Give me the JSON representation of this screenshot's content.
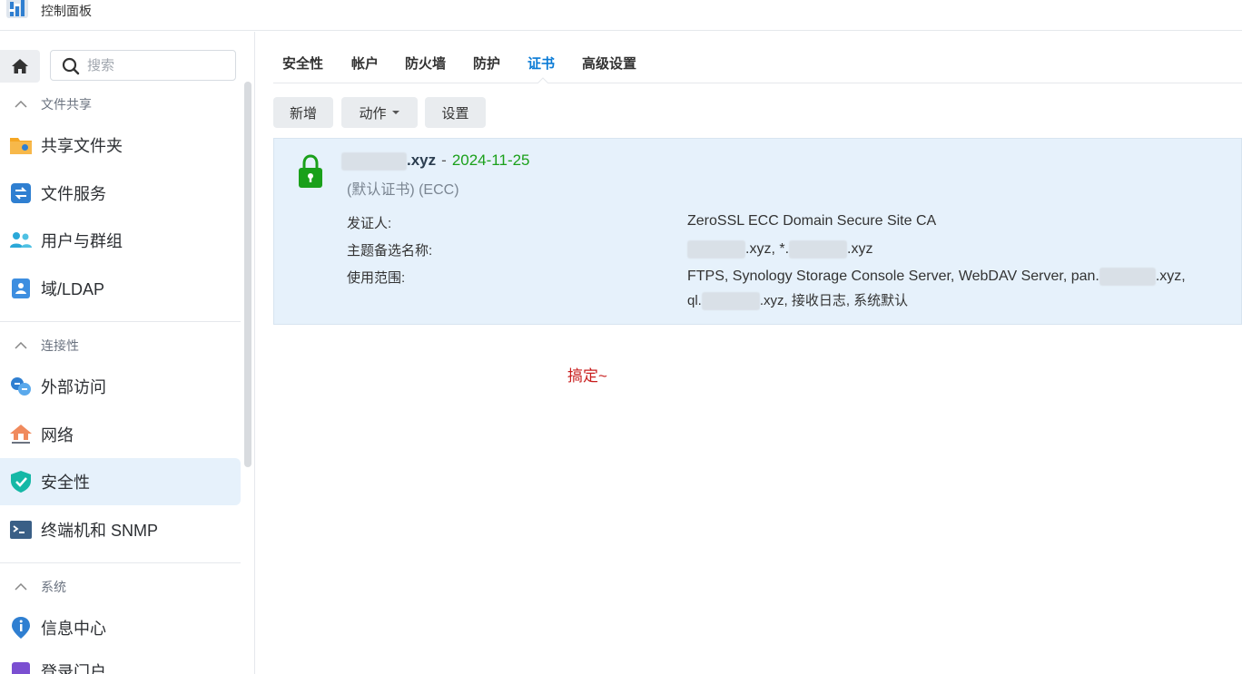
{
  "window": {
    "title": "控制面板"
  },
  "sidebar": {
    "search_placeholder": "搜索",
    "sections": [
      {
        "label": "文件共享",
        "items": [
          {
            "label": "共享文件夹",
            "icon": "folder-icon"
          },
          {
            "label": "文件服务",
            "icon": "file-services-icon"
          },
          {
            "label": "用户与群组",
            "icon": "users-icon"
          },
          {
            "label": "域/LDAP",
            "icon": "directory-icon"
          }
        ]
      },
      {
        "label": "连接性",
        "items": [
          {
            "label": "外部访问",
            "icon": "external-access-icon"
          },
          {
            "label": "网络",
            "icon": "network-house-icon"
          },
          {
            "label": "安全性",
            "icon": "shield-icon",
            "active": true
          },
          {
            "label": "终端机和 SNMP",
            "icon": "terminal-icon"
          }
        ]
      },
      {
        "label": "系统",
        "items": [
          {
            "label": "信息中心",
            "icon": "info-pin-icon"
          },
          {
            "label": "登录门户",
            "icon": "login-portal-icon"
          }
        ]
      }
    ]
  },
  "tabs": [
    {
      "label": "安全性"
    },
    {
      "label": "帐户"
    },
    {
      "label": "防火墙"
    },
    {
      "label": "防护"
    },
    {
      "label": "证书",
      "active": true
    },
    {
      "label": "高级设置"
    }
  ],
  "toolbar": {
    "add_label": "新增",
    "action_label": "动作",
    "settings_label": "设置"
  },
  "certificate": {
    "domain_suffix": ".xyz",
    "separator": "-",
    "expiry": "2024-11-25",
    "subtitle": "(默认证书) (ECC)",
    "issuer_label": "发证人:",
    "issuer_value": "ZeroSSL ECC Domain Secure Site CA",
    "san_label": "主题备选名称:",
    "san_part1": ".xyz, *.",
    "san_part2": ".xyz",
    "usage_label": "使用范围:",
    "usage_line1_a": "FTPS, Synology Storage Console Server, WebDAV Server, pan.",
    "usage_line1_b": ".xyz,",
    "usage_line2_a": "ql.",
    "usage_line2_b": ".xyz, 接收日志, 系统默认"
  },
  "annotation": {
    "text": "搞定~"
  },
  "colors": {
    "accent": "#0a7bd6",
    "date_green": "#1aa01a",
    "annotation_red": "#c81e1e",
    "selected_bg": "#e6f1fb"
  }
}
